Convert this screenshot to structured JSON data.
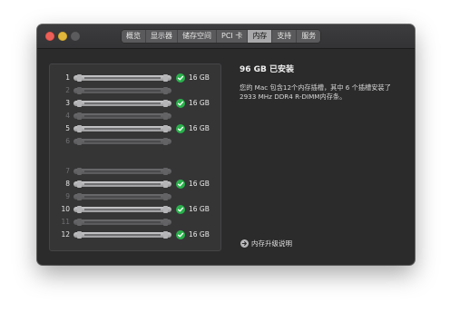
{
  "tabs": [
    {
      "label": "概览"
    },
    {
      "label": "显示器"
    },
    {
      "label": "储存空间"
    },
    {
      "label": "PCI 卡"
    },
    {
      "label": "内存",
      "active": true
    },
    {
      "label": "支持"
    },
    {
      "label": "服务"
    }
  ],
  "slots": [
    {
      "number": "1",
      "installed": true,
      "capacity": "16 GB"
    },
    {
      "number": "2",
      "installed": false,
      "capacity": ""
    },
    {
      "number": "3",
      "installed": true,
      "capacity": "16 GB"
    },
    {
      "number": "4",
      "installed": false,
      "capacity": ""
    },
    {
      "number": "5",
      "installed": true,
      "capacity": "16 GB"
    },
    {
      "number": "6",
      "installed": false,
      "capacity": ""
    },
    {
      "number": "7",
      "installed": false,
      "capacity": ""
    },
    {
      "number": "8",
      "installed": true,
      "capacity": "16 GB"
    },
    {
      "number": "9",
      "installed": false,
      "capacity": ""
    },
    {
      "number": "10",
      "installed": true,
      "capacity": "16 GB"
    },
    {
      "number": "11",
      "installed": false,
      "capacity": ""
    },
    {
      "number": "12",
      "installed": true,
      "capacity": "16 GB"
    }
  ],
  "info": {
    "title": "96 GB 已安装",
    "description": "您的 Mac 包含12个内存插槽，其中 6 个插槽安装了2933 MHz DDR4 R-DIMM内存条。"
  },
  "upgrade_link": {
    "label": "内存升级说明",
    "icon": "arrow-right-circle-icon"
  },
  "colors": {
    "check": "#29b24b",
    "window_bg": "#2b2b2c",
    "close": "#ec5f58",
    "minimize": "#e0b73a"
  }
}
